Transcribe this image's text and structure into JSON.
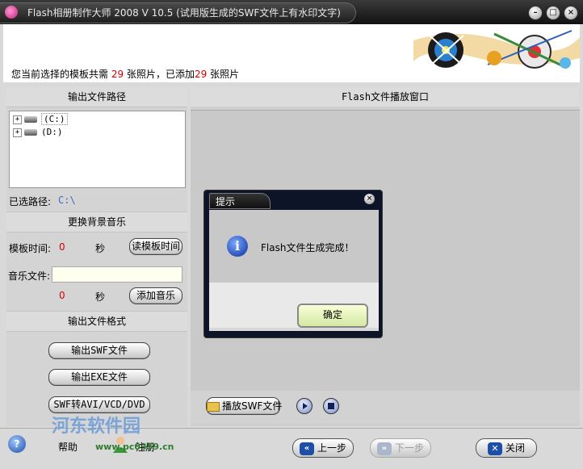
{
  "window": {
    "title": "Flash相册制作大师 2008 V 10.5 (试用版生成的SWF文件上有水印文字)"
  },
  "status": {
    "prefix": "您当前选择的模板共需",
    "needed": "29",
    "mid": "张照片，已添加",
    "added": "29",
    "suffix": "张照片"
  },
  "left": {
    "output_path_header": "输出文件路径",
    "drives": [
      "(C:)",
      "(D:)"
    ],
    "selected_path_label": "已选路径:",
    "selected_path_value": "C:\\",
    "bg_music_header": "更换背景音乐",
    "template_time_label": "模板时间:",
    "template_time_value": "0",
    "seconds_unit": "秒",
    "read_template_time_button": "读模板时间",
    "music_file_label": "音乐文件:",
    "music_file_value": "",
    "music_seconds_value": "0",
    "add_music_button": "添加音乐",
    "output_format_header": "输出文件格式",
    "export_swf_button": "输出SWF文件",
    "export_exe_button": "输出EXE文件",
    "swf_to_avi_button": "SWF转AVI/VCD/DVD"
  },
  "right": {
    "header": "Flash文件播放窗口",
    "play_swf_button": "播放SWF文件"
  },
  "dialog": {
    "title": "提示",
    "message": "Flash文件生成完成！",
    "ok_button": "确定"
  },
  "bottom": {
    "help_label": "帮助",
    "register_label": "注册",
    "prev_button": "上一步",
    "next_button": "下一步",
    "close_button": "关闭"
  },
  "watermark": {
    "text": "河东软件园",
    "url": "www.pc0359.cn"
  },
  "colors": {
    "accent_red": "#d40000",
    "path_blue": "#3a6fc4",
    "dialog_dark": "#0e1428"
  }
}
